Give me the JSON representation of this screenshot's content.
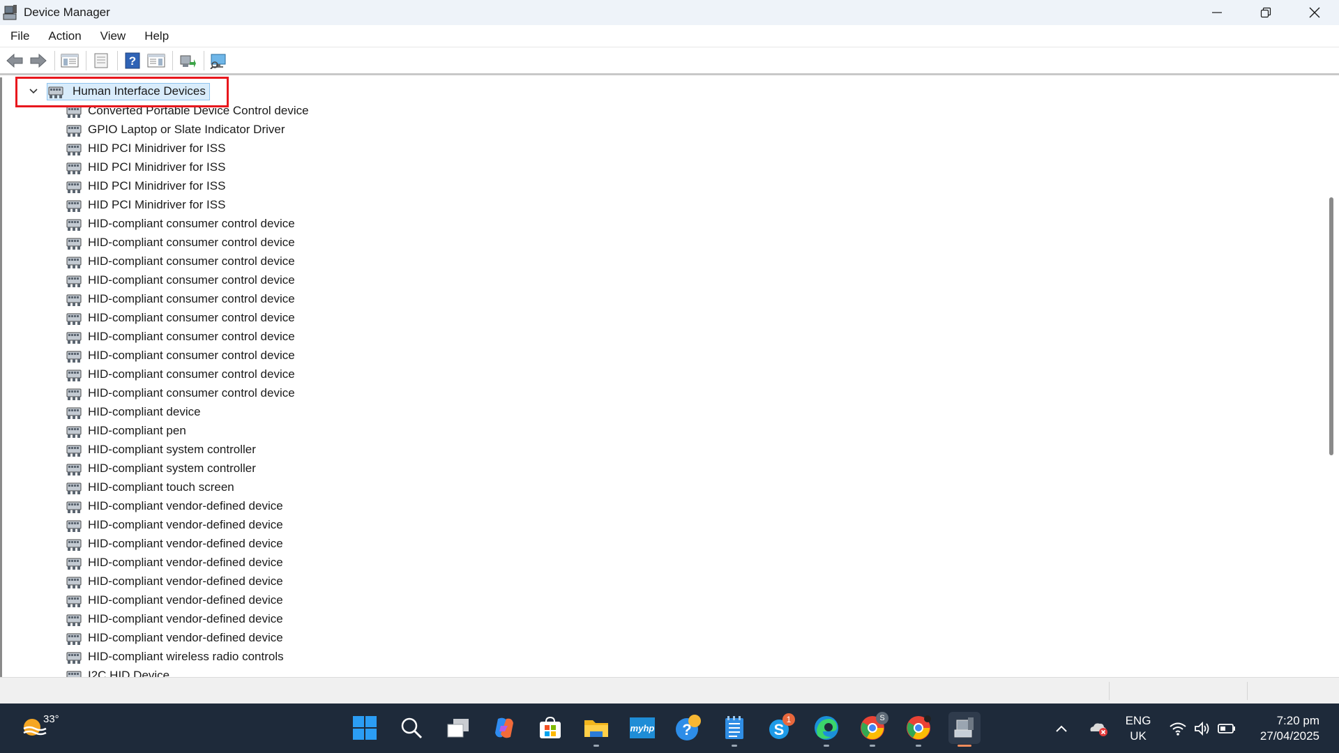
{
  "window": {
    "title": "Device Manager"
  },
  "menu": {
    "items": [
      "File",
      "Action",
      "View",
      "Help"
    ]
  },
  "toolbar": {
    "icons": [
      "back-arrow-icon",
      "forward-arrow-icon",
      "show-hide-console-tree-icon",
      "properties-icon",
      "help-icon",
      "action-pane-icon",
      "update-driver-icon",
      "scan-hardware-icon"
    ]
  },
  "tree": {
    "root_label": "Human Interface Devices",
    "expanded": true,
    "devices": [
      "Converted Portable Device Control device",
      "GPIO Laptop or Slate Indicator Driver",
      "HID PCI Minidriver for ISS",
      "HID PCI Minidriver for ISS",
      "HID PCI Minidriver for ISS",
      "HID PCI Minidriver for ISS",
      "HID-compliant consumer control device",
      "HID-compliant consumer control device",
      "HID-compliant consumer control device",
      "HID-compliant consumer control device",
      "HID-compliant consumer control device",
      "HID-compliant consumer control device",
      "HID-compliant consumer control device",
      "HID-compliant consumer control device",
      "HID-compliant consumer control device",
      "HID-compliant consumer control device",
      "HID-compliant device",
      "HID-compliant pen",
      "HID-compliant system controller",
      "HID-compliant system controller",
      "HID-compliant touch screen",
      "HID-compliant vendor-defined device",
      "HID-compliant vendor-defined device",
      "HID-compliant vendor-defined device",
      "HID-compliant vendor-defined device",
      "HID-compliant vendor-defined device",
      "HID-compliant vendor-defined device",
      "HID-compliant vendor-defined device",
      "HID-compliant vendor-defined device",
      "HID-compliant wireless radio controls",
      "I2C HID Device"
    ]
  },
  "taskbar": {
    "weather_temp": "33°",
    "apps": [
      {
        "name": "start-button",
        "icon": "windows-logo-icon"
      },
      {
        "name": "search-button",
        "icon": "search-icon"
      },
      {
        "name": "task-view-button",
        "icon": "task-view-icon"
      },
      {
        "name": "copilot-button",
        "icon": "copilot-icon"
      },
      {
        "name": "microsoft-store-button",
        "icon": "store-icon"
      },
      {
        "name": "file-explorer-button",
        "icon": "folder-icon"
      },
      {
        "name": "myhp-button",
        "icon": "myhp-icon"
      },
      {
        "name": "get-help-button",
        "icon": "help-bubble-icon"
      },
      {
        "name": "notepad-button",
        "icon": "notepad-icon"
      },
      {
        "name": "skype-button",
        "icon": "skype-icon"
      },
      {
        "name": "edge-button",
        "icon": "edge-icon"
      },
      {
        "name": "chrome-profile-s-button",
        "icon": "chrome-icon"
      },
      {
        "name": "chrome-button",
        "icon": "chrome-icon"
      },
      {
        "name": "device-manager-taskbar-button",
        "icon": "device-manager-icon"
      }
    ],
    "myhp_text": "myhp",
    "skype_badge": "1",
    "chrome_profile_letter": "S",
    "tray": {
      "language": "ENG",
      "region": "UK",
      "time": "7:20 pm",
      "date": "27/04/2025"
    }
  },
  "colors": {
    "taskbar_bg": "#1e2a3a",
    "titlebar_bg": "#eef3f9",
    "selection_bg": "#d9ecfb",
    "highlight_red": "#e8171d"
  }
}
